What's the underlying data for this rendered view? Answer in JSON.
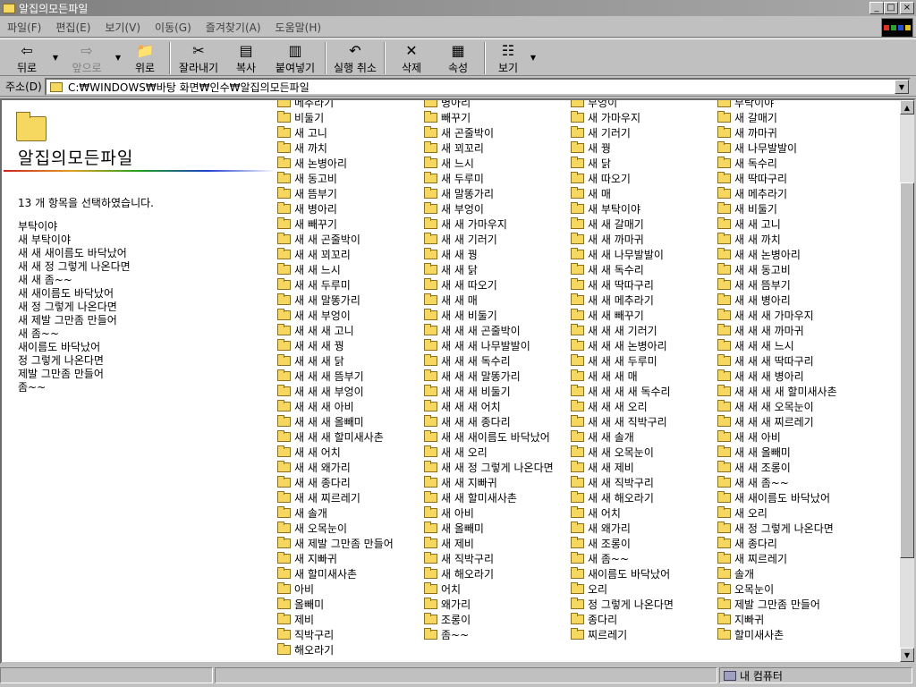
{
  "window": {
    "title": "알집의모든파일",
    "controls": {
      "minimize": "_",
      "maximize": "□",
      "close": "×"
    }
  },
  "menu": [
    "파일(F)",
    "편집(E)",
    "보기(V)",
    "이동(G)",
    "즐겨찾기(A)",
    "도움말(H)"
  ],
  "toolbar": {
    "back": "뒤로",
    "forward": "앞으로",
    "up": "위로",
    "cut": "잘라내기",
    "copy": "복사",
    "paste": "붙여넣기",
    "undo": "실행 취소",
    "delete": "삭제",
    "properties": "속성",
    "view": "보기"
  },
  "address": {
    "label": "주소(D)",
    "value": "C:₩WINDOWS₩바탕 화면₩인수₩알집의모든파일"
  },
  "left_pane": {
    "folder_title": "알집의모든파일",
    "selection_info": "13 개 항목을 선택하였습니다.",
    "selected_items": [
      "부탁이야",
      "새 부탁이야",
      "새 새 새이름도 바닥났어",
      "새 새 정 그렇게 나온다면",
      "새 새 좀~~",
      "새 새이름도 바닥났어",
      "새 정 그렇게 나온다면",
      "새 제발 그만좀 만들어",
      "새 좀~~",
      "새이름도 바닥났어",
      "정 그렇게 나온다면",
      "제발 그만좀 만들어",
      "좀~~"
    ]
  },
  "files": {
    "columns": [
      [
        "메추라기",
        "비둘기",
        "새 고니",
        "새 까치",
        "새 논병아리",
        "새 동고비",
        "새 뜸부기",
        "새 병아리",
        "새 빼꾸기",
        "새 새 곤줄박이",
        "새 새 꾀꼬리",
        "새 새 느시",
        "새 새 두루미",
        "새 새 말똥가리",
        "새 새 부엉이",
        "새 새 새 고니",
        "새 새 새 꿩",
        "새 새 새 닭",
        "새 새 새 뜸부기",
        "새 새 새 부엉이",
        "새 새 새 아비",
        "새 새 새 올빼미",
        "새 새 새 할미새사촌",
        "새 새 어치",
        "새 새 왜가리",
        "새 새 종다리",
        "새 새 찌르레기",
        "새 솔개",
        "새 오목눈이",
        "새 제발 그만좀 만들어",
        "새 지빠귀",
        "새 할미새사촌",
        "아비",
        "올빼미",
        "제비",
        "직박구리",
        "해오라기"
      ],
      [
        "병아리",
        "빼꾸기",
        "새 곤줄박이",
        "새 꾀꼬리",
        "새 느시",
        "새 두루미",
        "새 말똥가리",
        "새 부엉이",
        "새 새 가마우지",
        "새 새 기러기",
        "새 새 꿩",
        "새 새 닭",
        "새 새 따오기",
        "새 새 매",
        "새 새 비둘기",
        "새 새 새 곤줄박이",
        "새 새 새 나무발발이",
        "새 새 새 독수리",
        "새 새 새 말똥가리",
        "새 새 새 비둘기",
        "새 새 새 어치",
        "새 새 새 종다리",
        "새 새 새이름도 바닥났어",
        "새 새 오리",
        "새 새 정 그렇게 나온다면",
        "새 새 지빠귀",
        "새 새 할미새사촌",
        "새 아비",
        "새 올빼미",
        "새 제비",
        "새 직박구리",
        "새 해오라기",
        "어치",
        "왜가리",
        "조롱이",
        "좀~~"
      ],
      [
        "부엉이",
        "새 가마우지",
        "새 기러기",
        "새 꿩",
        "새 닭",
        "새 따오기",
        "새 매",
        "새 부탁이야",
        "새 새 갈매기",
        "새 새 까마귀",
        "새 새 나무발발이",
        "새 새 독수리",
        "새 새 딱따구리",
        "새 새 메추라기",
        "새 새 빼꾸기",
        "새 새 새 기러기",
        "새 새 새 논병아리",
        "새 새 새 두루미",
        "새 새 새 매",
        "새 새 새 새 독수리",
        "새 새 새 오리",
        "새 새 새 직박구리",
        "새 새 솔개",
        "새 새 오목눈이",
        "새 새 제비",
        "새 새 직박구리",
        "새 새 해오라기",
        "새 어치",
        "새 왜가리",
        "새 조롱이",
        "새 좀~~",
        "새이름도 바닥났어",
        "오리",
        "정 그렇게 나온다면",
        "종다리",
        "찌르레기"
      ],
      [
        "부탁이야",
        "새 갈매기",
        "새 까마귀",
        "새 나무발발이",
        "새 독수리",
        "새 딱따구리",
        "새 메추라기",
        "새 비둘기",
        "새 새 고니",
        "새 새 까치",
        "새 새 논병아리",
        "새 새 동고비",
        "새 새 뜸부기",
        "새 새 병아리",
        "새 새 새 가마우지",
        "새 새 새 까마귀",
        "새 새 새 느시",
        "새 새 새 딱따구리",
        "새 새 새 병아리",
        "새 새 새 새 할미새사촌",
        "새 새 새 오목눈이",
        "새 새 새 찌르레기",
        "새 새 아비",
        "새 새 올빼미",
        "새 새 조롱이",
        "새 새 좀~~",
        "새 새이름도 바닥났어",
        "새 오리",
        "새 정 그렇게 나온다면",
        "새 종다리",
        "새 찌르레기",
        "솔개",
        "오목눈이",
        "제발 그만좀 만들어",
        "지빠귀",
        "할미새사촌"
      ]
    ]
  },
  "status": {
    "panel1": "",
    "panel2": "",
    "zone": "내 컴퓨터"
  },
  "colors": {
    "folder": "#f6d860",
    "window_face": "#c0c0c0",
    "titlebar_inactive": "#808080"
  }
}
